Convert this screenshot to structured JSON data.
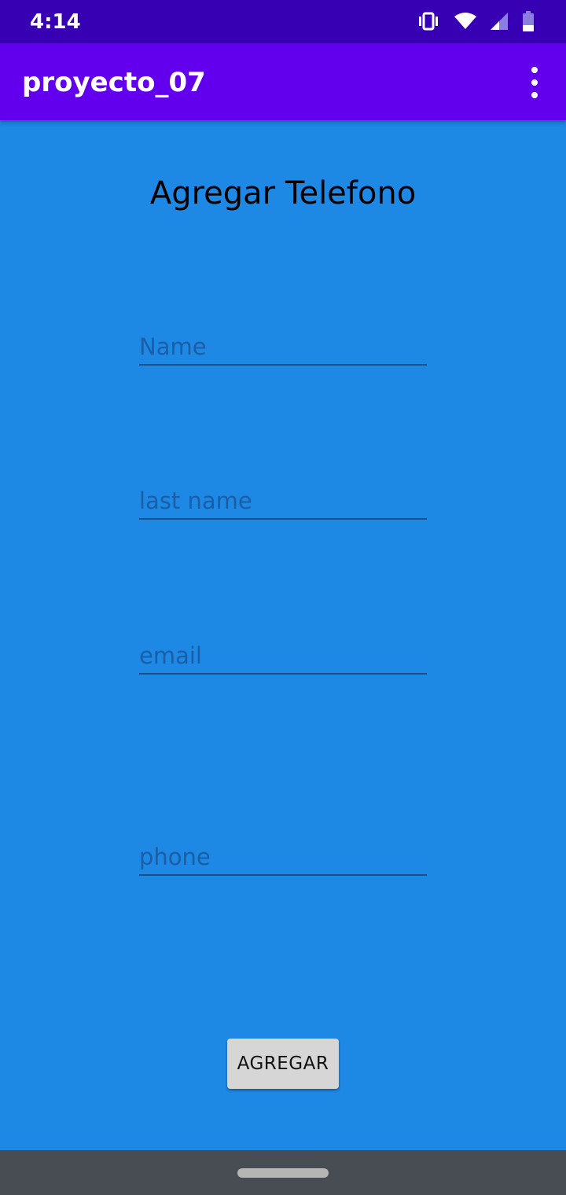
{
  "status_bar": {
    "time": "4:14",
    "icons": [
      "vibrate-icon",
      "wifi-icon",
      "signal-icon",
      "battery-icon"
    ]
  },
  "app_bar": {
    "title": "proyecto_07",
    "menu_icon": "overflow-menu-icon"
  },
  "form": {
    "title": "Agregar Telefono",
    "fields": [
      {
        "placeholder": "Name",
        "value": ""
      },
      {
        "placeholder": "last name",
        "value": ""
      },
      {
        "placeholder": "email",
        "value": ""
      },
      {
        "placeholder": "phone",
        "value": ""
      }
    ],
    "submit_label": "AGREGAR"
  },
  "colors": {
    "status_bar": "#3700b3",
    "app_bar": "#6200ee",
    "background": "#1e88e5",
    "button": "#d6d6d6",
    "nav_bar": "#474d52"
  }
}
